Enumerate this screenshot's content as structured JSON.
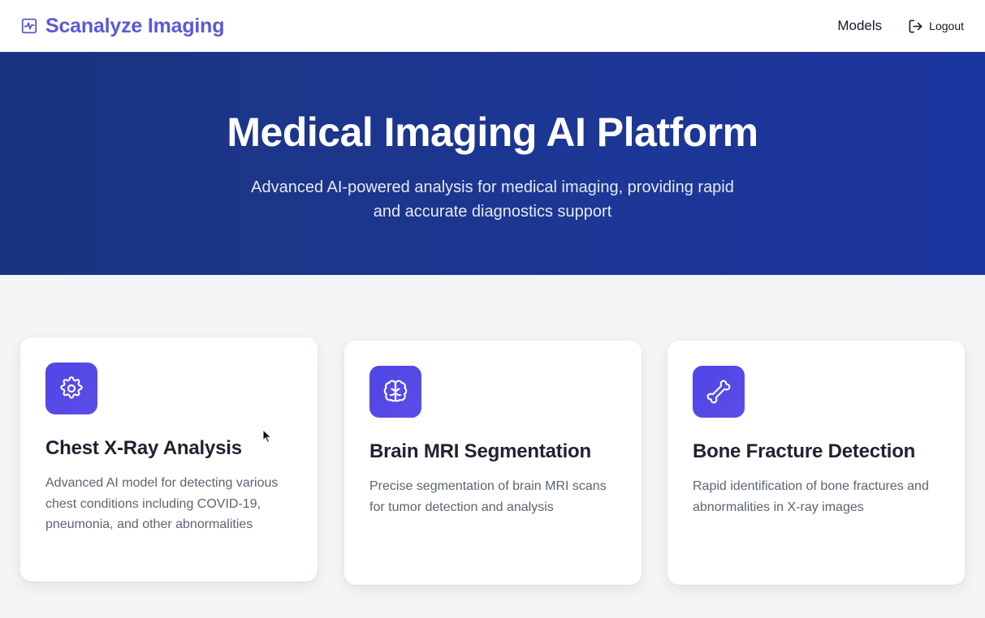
{
  "navbar": {
    "brand_name": "Scanalyze Imaging",
    "brand_icon": "activity-icon",
    "models_label": "Models",
    "logout_label": "Logout",
    "logout_icon": "logout-icon"
  },
  "hero": {
    "title": "Medical Imaging AI Platform",
    "subtitle": "Advanced AI-powered analysis for medical imaging, providing rapid and accurate diagnostics support"
  },
  "cards": [
    {
      "icon": "gear-icon",
      "title": "Chest X-Ray Analysis",
      "description": "Advanced AI model for detecting various chest conditions including COVID-19, pneumonia, and other abnormalities"
    },
    {
      "icon": "brain-icon",
      "title": "Brain MRI Segmentation",
      "description": "Precise segmentation of brain MRI scans for tumor detection and analysis"
    },
    {
      "icon": "bone-icon",
      "title": "Bone Fracture Detection",
      "description": "Rapid identification of bone fractures and abnormalities in X-ray images"
    }
  ],
  "colors": {
    "brand": "#5a5ad6",
    "hero_bg": "#1c3793",
    "icon_bg": "#4f46e5",
    "page_bg": "#f4f5f7"
  }
}
